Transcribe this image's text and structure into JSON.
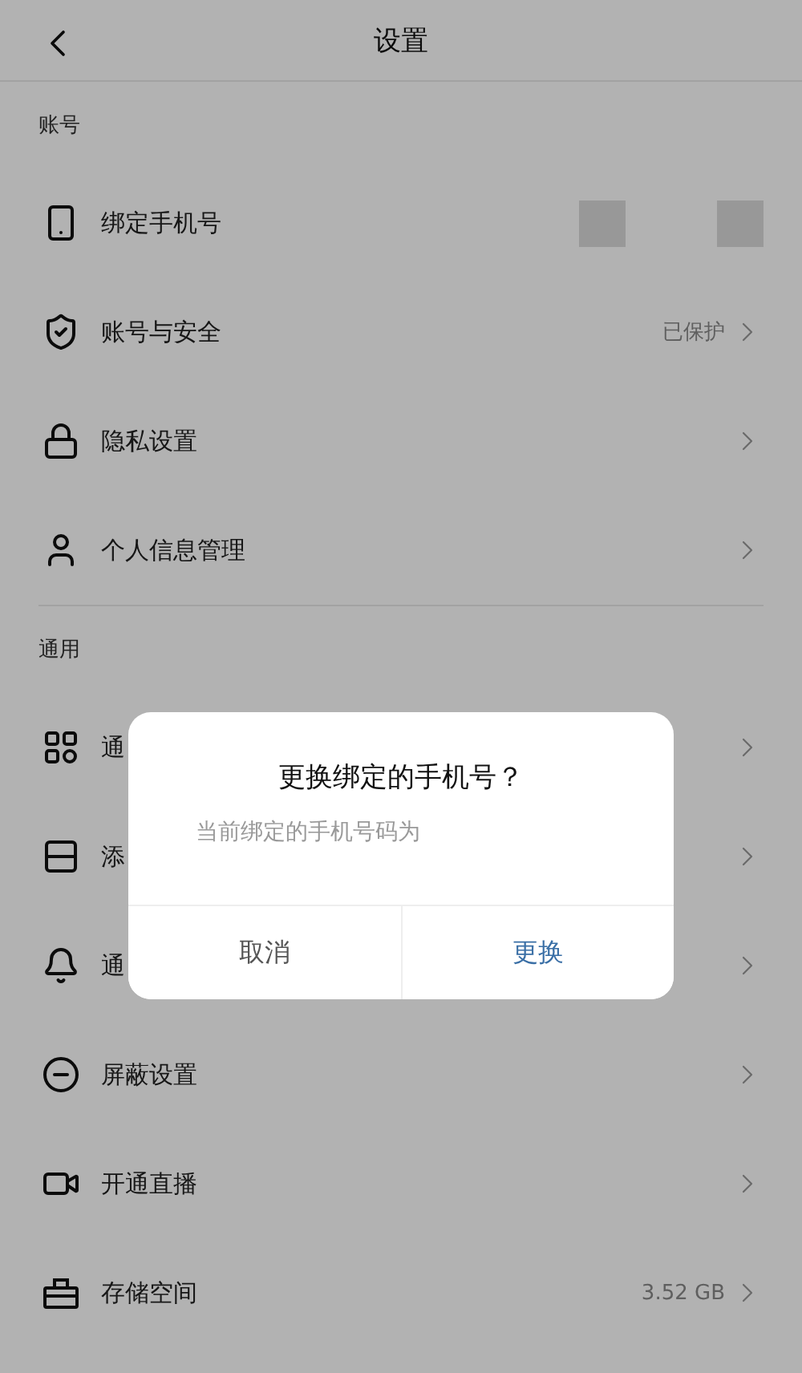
{
  "header": {
    "title": "设置"
  },
  "sections": [
    {
      "title": "账号",
      "rows": [
        {
          "label": "绑定手机号",
          "masked": true,
          "chevron": false
        },
        {
          "label": "账号与安全",
          "value": "已保护",
          "chevron": true
        },
        {
          "label": "隐私设置",
          "chevron": true
        },
        {
          "label": "个人信息管理",
          "chevron": true
        }
      ]
    },
    {
      "title": "通用",
      "rows": [
        {
          "label": "通",
          "chevron": true
        },
        {
          "label": "添",
          "chevron": true
        },
        {
          "label": "通",
          "chevron": true
        },
        {
          "label": "屏蔽设置",
          "chevron": true
        },
        {
          "label": "开通直播",
          "chevron": true
        },
        {
          "label": "存储空间",
          "value": "3.52 GB",
          "chevron": true
        }
      ]
    }
  ],
  "dialog": {
    "title": "更换绑定的手机号？",
    "message": "当前绑定的手机号码为",
    "buttons": [
      {
        "label": "取消",
        "kind": "cancel"
      },
      {
        "label": "更换",
        "kind": "confirm"
      }
    ]
  }
}
